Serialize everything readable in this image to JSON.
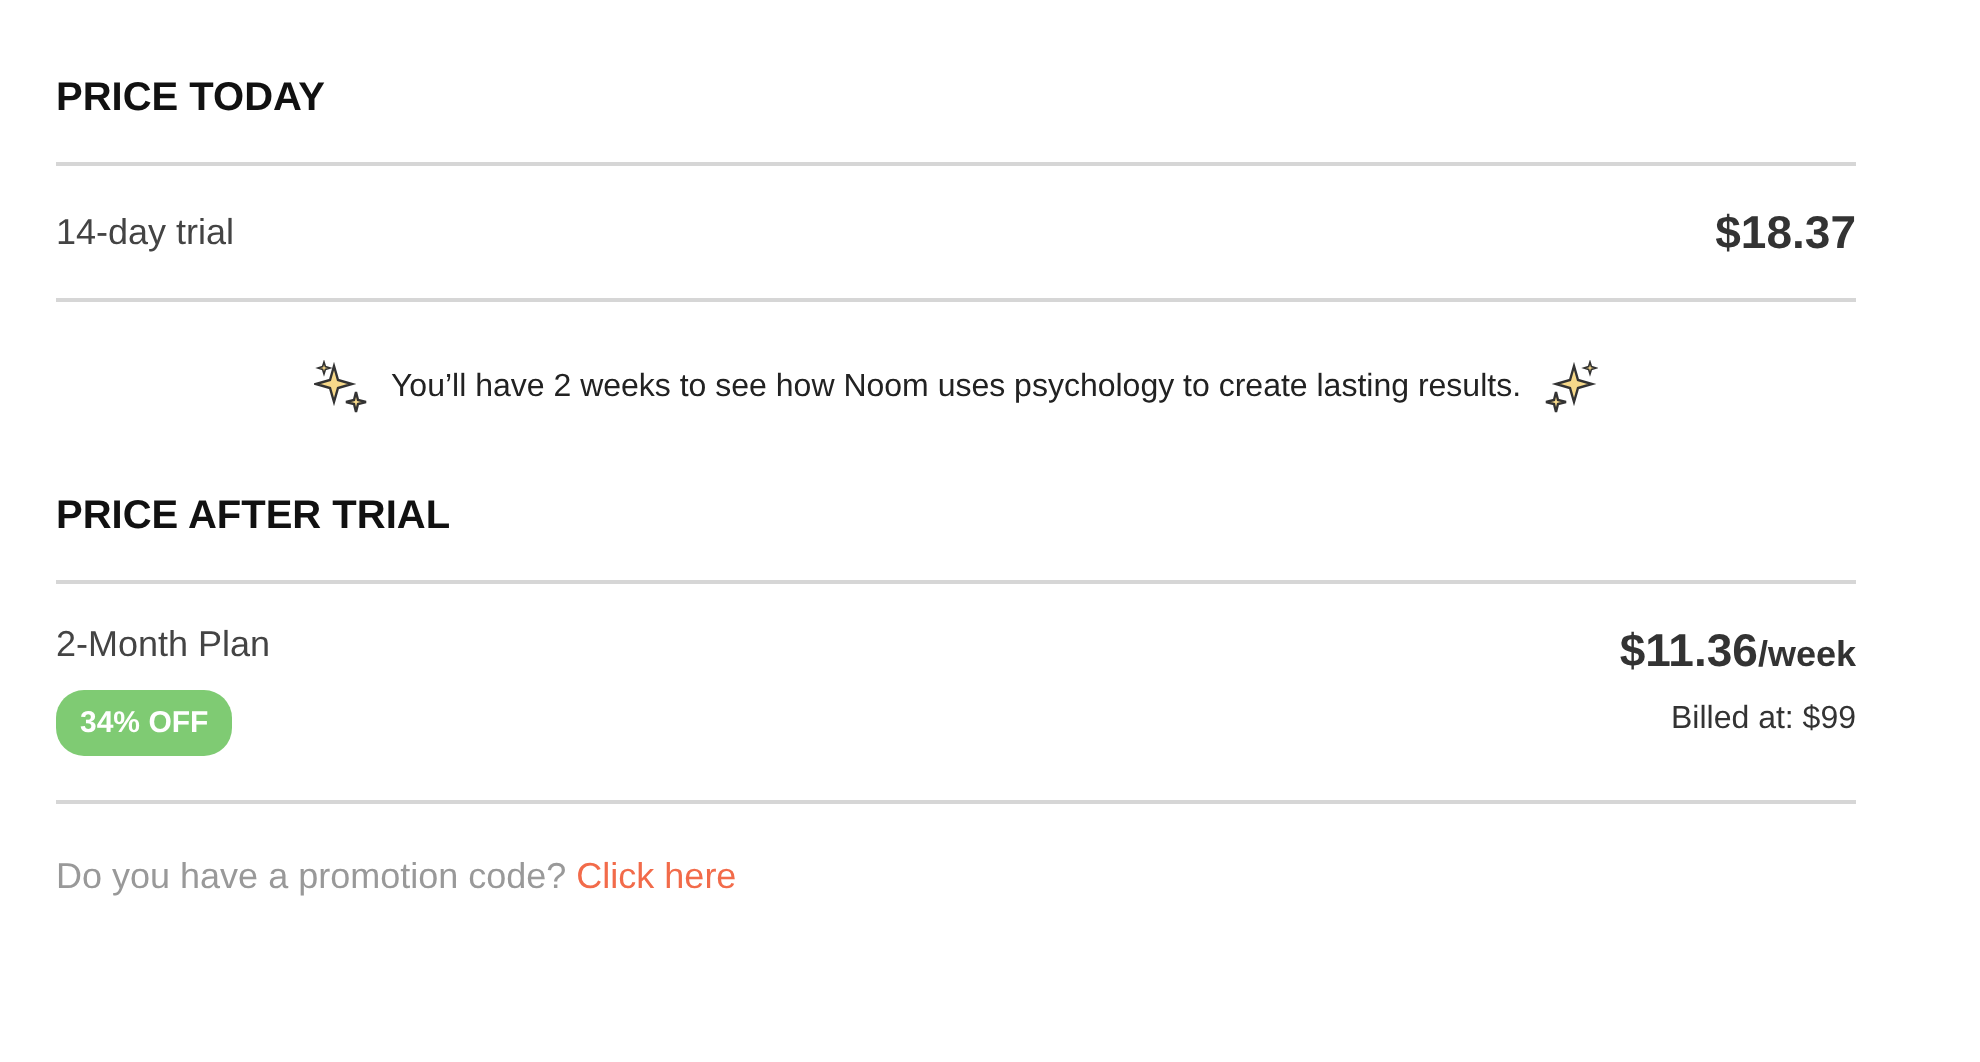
{
  "today": {
    "heading": "PRICE TODAY",
    "label": "14-day trial",
    "price": "$18.37"
  },
  "note": {
    "text": "You’ll have 2 weeks to see how Noom uses psychology to create lasting results."
  },
  "after": {
    "heading": "PRICE AFTER TRIAL",
    "label": "2-Month Plan",
    "price": "$11.36",
    "unit": "/week",
    "badge": "34% OFF",
    "billed": "Billed at: $99"
  },
  "promo": {
    "text": "Do you have a promotion code?",
    "link": "Click here"
  }
}
